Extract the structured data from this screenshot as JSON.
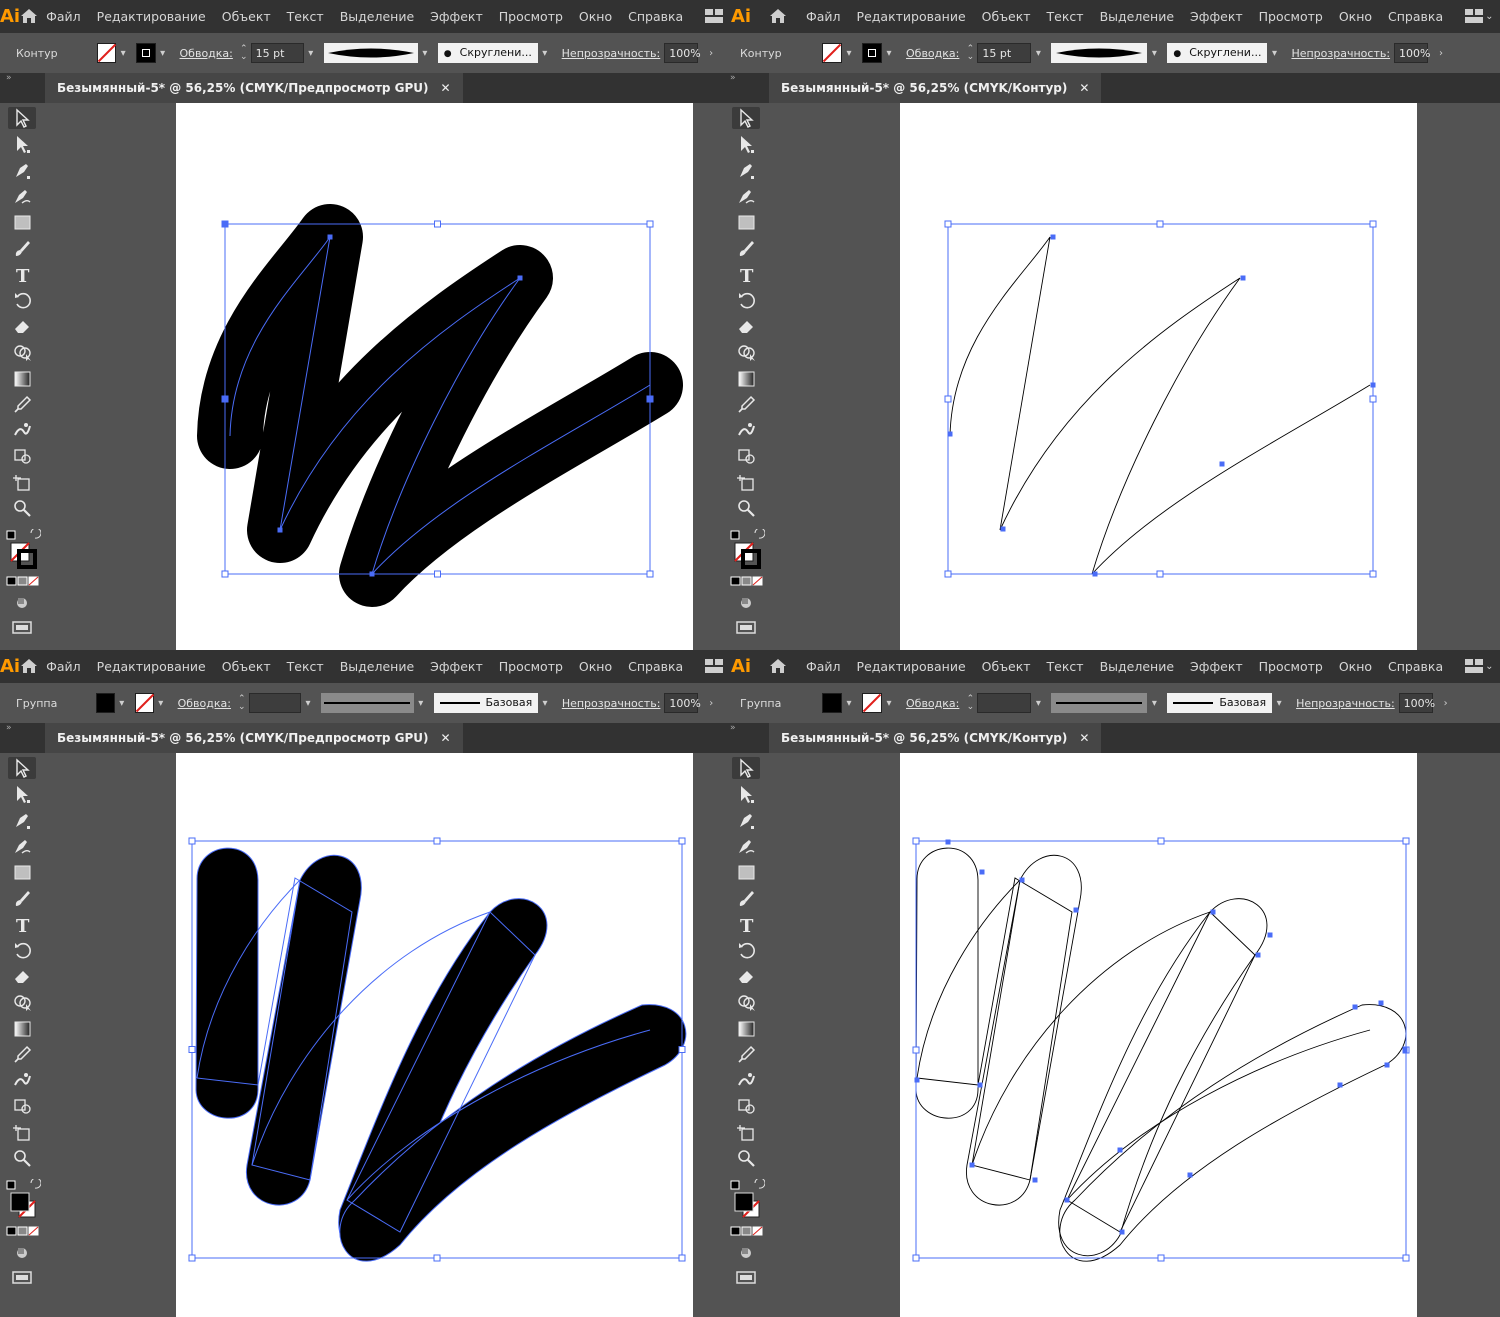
{
  "app": {
    "logo_text": "Ai"
  },
  "menu": [
    "Файл",
    "Редактирование",
    "Объект",
    "Текст",
    "Выделение",
    "Эффект",
    "Просмотр",
    "Окно",
    "Справка"
  ],
  "panels": [
    {
      "id": "tl",
      "selection_label": "Контур",
      "fill": "none",
      "stroke_swatch": "stroke",
      "stroke_label": "Обводка:",
      "stroke_weight": "15 pt",
      "profile": "taper",
      "brush_label": "Скруглени...",
      "opacity_label": "Непрозрачность:",
      "opacity_value": "100%",
      "tab_title": "Безымянный-5* @ 56,25% (CMYK/Предпросмотр GPU)",
      "tab_close": "✕",
      "view": "preview-path"
    },
    {
      "id": "tr",
      "selection_label": "Контур",
      "fill": "none",
      "stroke_swatch": "stroke",
      "stroke_label": "Обводка:",
      "stroke_weight": "15 pt",
      "profile": "taper",
      "brush_label": "Скруглени...",
      "opacity_label": "Непрозрачность:",
      "opacity_value": "100%",
      "tab_title": "Безымянный-5* @ 56,25% (CMYK/Контур)",
      "tab_close": "✕",
      "view": "outline-path"
    },
    {
      "id": "bl",
      "selection_label": "Группа",
      "fill": "black",
      "stroke_swatch": "none",
      "stroke_label": "Обводка:",
      "stroke_weight": "",
      "profile": "uniform",
      "brush_label": "Базовая",
      "opacity_label": "Непрозрачность:",
      "opacity_value": "100%",
      "tab_title": "Безымянный-5* @ 56,25% (CMYK/Предпросмотр GPU)",
      "tab_close": "✕",
      "view": "preview-expanded"
    },
    {
      "id": "br",
      "selection_label": "Группа",
      "fill": "black",
      "stroke_swatch": "none",
      "stroke_label": "Обводка:",
      "stroke_weight": "",
      "profile": "uniform",
      "brush_label": "Базовая",
      "opacity_label": "Непрозрачность:",
      "opacity_value": "100%",
      "tab_title": "Безымянный-5* @ 56,25% (CMYK/Контур)",
      "tab_close": "✕",
      "view": "outline-expanded"
    }
  ],
  "tools": [
    "selection-tool",
    "direct-selection-tool",
    "pen-tool",
    "curvature-tool",
    "rectangle-tool",
    "paintbrush-tool",
    "type-tool",
    "rotate-tool",
    "eraser-tool",
    "shape-builder-tool",
    "gradient-tool",
    "eyedropper-tool",
    "puppet-warp-tool",
    "symbol-sprayer-tool",
    "artboard-tool",
    "zoom-tool"
  ],
  "colors": {
    "accent": "#ff9a00",
    "selection": "#4a6cf7",
    "ui_dark": "#323232",
    "ui_mid": "#535353"
  }
}
